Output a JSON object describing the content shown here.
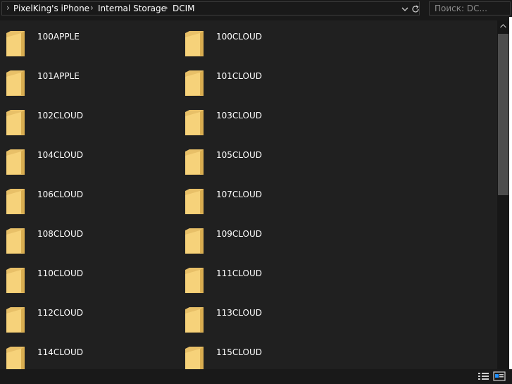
{
  "address_bar": {
    "crumbs": [
      "PixelKing's iPhone",
      "Internal Storage",
      "DCIM"
    ]
  },
  "search": {
    "placeholder": "Поиск: DC..."
  },
  "folders": [
    "100APPLE",
    "100CLOUD",
    "101APPLE",
    "101CLOUD",
    "102CLOUD",
    "103CLOUD",
    "104CLOUD",
    "105CLOUD",
    "106CLOUD",
    "107CLOUD",
    "108CLOUD",
    "109CLOUD",
    "110CLOUD",
    "111CLOUD",
    "112CLOUD",
    "113CLOUD",
    "114CLOUD",
    "115CLOUD"
  ],
  "icons": {
    "folder": "folder-icon",
    "chevron": "chevron-right-icon",
    "dropdown": "chevron-down-icon",
    "refresh": "refresh-icon",
    "search": "search-icon",
    "details_view": "details-view-icon",
    "tiles_view": "large-icons-view-icon"
  },
  "colors": {
    "background": "#202020",
    "folder_yellow": "#f6d27a",
    "text": "#ffffff",
    "accent": "#1e90ff"
  }
}
